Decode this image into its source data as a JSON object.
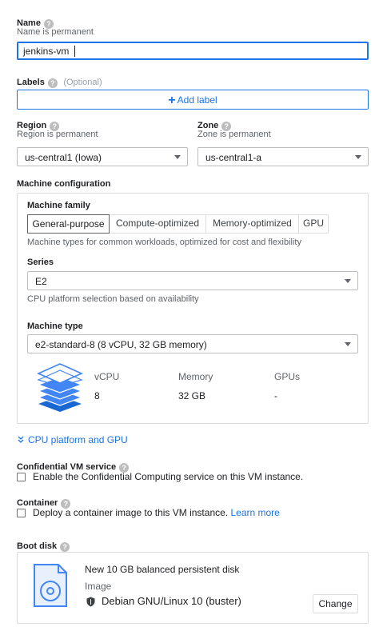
{
  "name": {
    "label": "Name",
    "hint": "Name is permanent",
    "value": "jenkins-vm"
  },
  "labels": {
    "label": "Labels",
    "optional": "(Optional)",
    "add_button": "Add label"
  },
  "region": {
    "label": "Region",
    "hint": "Region is permanent",
    "value": "us-central1 (Iowa)"
  },
  "zone": {
    "label": "Zone",
    "hint": "Zone is permanent",
    "value": "us-central1-a"
  },
  "machine_config": {
    "heading": "Machine configuration",
    "family_label": "Machine family",
    "tabs": [
      "General-purpose",
      "Compute-optimized",
      "Memory-optimized",
      "GPU"
    ],
    "selected_tab": "General-purpose",
    "family_desc": "Machine types for common workloads, optimized for cost and flexibility",
    "series_label": "Series",
    "series_value": "E2",
    "series_hint": "CPU platform selection based on availability",
    "type_label": "Machine type",
    "type_value": "e2-standard-8 (8 vCPU, 32 GB memory)",
    "specs": {
      "vcpu_label": "vCPU",
      "vcpu_value": "8",
      "memory_label": "Memory",
      "memory_value": "32 GB",
      "gpus_label": "GPUs",
      "gpus_value": "-"
    }
  },
  "cpu_platform_link": "CPU platform and GPU",
  "confidential": {
    "label": "Confidential VM service",
    "checkbox_text": "Enable the Confidential Computing service on this VM instance."
  },
  "container": {
    "label": "Container",
    "checkbox_text": "Deploy a container image to this VM instance.",
    "learn_more": "Learn more"
  },
  "boot_disk": {
    "label": "Boot disk",
    "title": "New 10 GB balanced persistent disk",
    "image_label": "Image",
    "image_value": "Debian GNU/Linux 10 (buster)",
    "change_button": "Change"
  },
  "colors": {
    "accent": "#1a73e8",
    "stack_icon": "#4285f4"
  },
  "icons": [
    "help-icon",
    "plus-icon",
    "dropdown-caret-icon",
    "machine-stack-icon",
    "chevron-double-down-icon",
    "disk-icon",
    "shield-icon"
  ]
}
